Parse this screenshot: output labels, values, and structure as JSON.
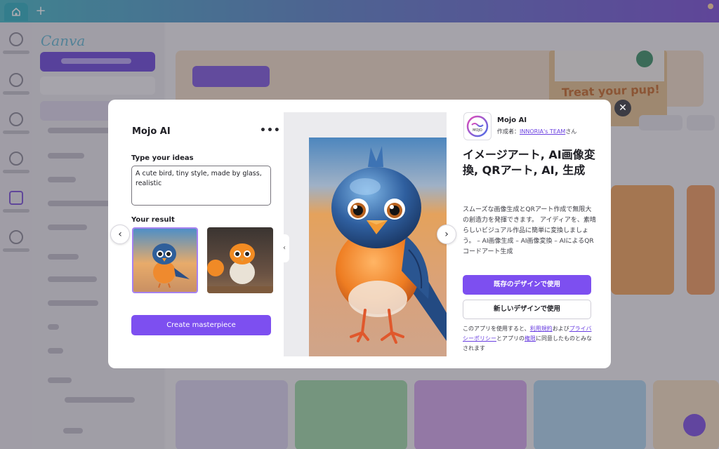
{
  "browser": {
    "new_tab_symbol": "+"
  },
  "modal": {
    "app_title": "Mojo AI",
    "more_symbol": "•••",
    "close_symbol": "✕",
    "prompt_label": "Type your ideas",
    "prompt_value": "A cute bird, tiny style, made by glass, realistic",
    "result_label": "Your result",
    "prev_symbol": "‹",
    "next_symbol": "›",
    "collapse_symbol": "‹",
    "create_button": "Create masterpiece"
  },
  "app_info": {
    "icon_text": "MOJO",
    "name": "Mojo AI",
    "author_prefix": "作成者：",
    "author_link": "INNORIA's TEAM",
    "author_suffix": "さん",
    "headline": "イメージアート, AI画像変換, QRアート, AI, 生成",
    "description": "スムーズな画像生成とQRアート作成で無限大の創造力を発揮できます。 アイディアを、素晴らしいビジュアル作品に簡単に変換しましょう。 – AI画像生成 – AI画像変換 – AIによるQRコードアート生成",
    "use_existing_button": "既存のデザインで使用",
    "use_new_button": "新しいデザインで使用",
    "legal_1": "このアプリを使用すると、",
    "terms_link": "利用規約",
    "legal_2": "および",
    "privacy_link": "プライバシーポリシー",
    "legal_3": "とアプリの",
    "permissions_link": "権限",
    "legal_4": "に同意したものとみなされます"
  },
  "background": {
    "promo_text": "Treat your pup!"
  },
  "colors": {
    "accent": "#7d4ff0",
    "link": "#6a3fe0",
    "tab_gradient_start": "#44b9c7",
    "tab_gradient_end": "#7a4fd6"
  }
}
